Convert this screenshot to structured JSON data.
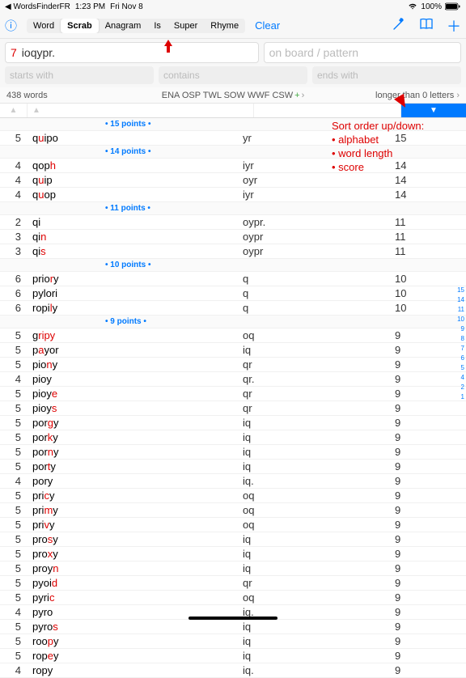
{
  "status": {
    "back": "WordsFinderFR",
    "time": "1:23 PM",
    "date": "Fri Nov 8",
    "battery": "100%"
  },
  "tabs": [
    "Word",
    "Scrab",
    "Anagram",
    "Is",
    "Super",
    "Rhyme"
  ],
  "clear": "Clear",
  "input": {
    "num": "7",
    "letters": "ioqypr.",
    "pattern_ph": "on board / pattern"
  },
  "filters": {
    "starts": "starts with",
    "contains": "contains",
    "ends": "ends with"
  },
  "info": {
    "count": "438 words",
    "dicts": "ENA OSP TWL SOW WWF CSW",
    "length": "longer than 0 letters"
  },
  "annotation": {
    "title": "Sort order up/down:",
    "l1": "• alphabet",
    "l2": "• word length",
    "l3": "• score"
  },
  "index": [
    "15",
    "14",
    "11",
    "10",
    "9",
    "8",
    "7",
    "6",
    "5",
    "4",
    "2",
    "1"
  ],
  "sections": [
    {
      "hdr": "• 15 points •",
      "rows": [
        {
          "n": "5",
          "w": [
            "q",
            "u",
            "ipo"
          ],
          "r": "yr",
          "s": "15"
        }
      ]
    },
    {
      "hdr": "• 14 points •",
      "rows": [
        {
          "n": "4",
          "w": [
            "qop",
            "h"
          ],
          "r": "iyr",
          "s": "14"
        },
        {
          "n": "4",
          "w": [
            "q",
            "u",
            "ip"
          ],
          "r": "oyr",
          "s": "14"
        },
        {
          "n": "4",
          "w": [
            "q",
            "u",
            "op"
          ],
          "r": "iyr",
          "s": "14"
        }
      ]
    },
    {
      "hdr": "• 11 points •",
      "rows": [
        {
          "n": "2",
          "w": [
            "qi"
          ],
          "r": "oypr.",
          "s": "11"
        },
        {
          "n": "3",
          "w": [
            "qi",
            "n"
          ],
          "r": "oypr",
          "s": "11"
        },
        {
          "n": "3",
          "w": [
            "qi",
            "s"
          ],
          "r": "oypr",
          "s": "11"
        }
      ]
    },
    {
      "hdr": "• 10 points •",
      "rows": [
        {
          "n": "6",
          "w": [
            "prio",
            "r",
            "y"
          ],
          "r": "q",
          "s": "10"
        },
        {
          "n": "6",
          "w": [
            "pylori"
          ],
          "r": "q",
          "s": "10"
        },
        {
          "n": "6",
          "w": [
            "ropi",
            "l",
            "y"
          ],
          "r": "q",
          "s": "10"
        }
      ]
    },
    {
      "hdr": "• 9 points •",
      "rows": [
        {
          "n": "5",
          "w": [
            "g",
            "ripy"
          ],
          "r": "oq",
          "s": "9"
        },
        {
          "n": "5",
          "w": [
            "p",
            "a",
            "yor"
          ],
          "r": "iq",
          "s": "9"
        },
        {
          "n": "5",
          "w": [
            "pio",
            "n",
            "y"
          ],
          "r": "qr",
          "s": "9"
        },
        {
          "n": "4",
          "w": [
            "pioy"
          ],
          "r": "qr.",
          "s": "9"
        },
        {
          "n": "5",
          "w": [
            "pioy",
            "e"
          ],
          "r": "qr",
          "s": "9"
        },
        {
          "n": "5",
          "w": [
            "pioy",
            "s"
          ],
          "r": "qr",
          "s": "9"
        },
        {
          "n": "5",
          "w": [
            "por",
            "g",
            "y"
          ],
          "r": "iq",
          "s": "9"
        },
        {
          "n": "5",
          "w": [
            "por",
            "k",
            "y"
          ],
          "r": "iq",
          "s": "9"
        },
        {
          "n": "5",
          "w": [
            "por",
            "n",
            "y"
          ],
          "r": "iq",
          "s": "9"
        },
        {
          "n": "5",
          "w": [
            "por",
            "t",
            "y"
          ],
          "r": "iq",
          "s": "9"
        },
        {
          "n": "4",
          "w": [
            "pory"
          ],
          "r": "iq.",
          "s": "9"
        },
        {
          "n": "5",
          "w": [
            "pri",
            "c",
            "y"
          ],
          "r": "oq",
          "s": "9"
        },
        {
          "n": "5",
          "w": [
            "pri",
            "m",
            "y"
          ],
          "r": "oq",
          "s": "9"
        },
        {
          "n": "5",
          "w": [
            "pri",
            "v",
            "y"
          ],
          "r": "oq",
          "s": "9"
        },
        {
          "n": "5",
          "w": [
            "pro",
            "s",
            "y"
          ],
          "r": "iq",
          "s": "9"
        },
        {
          "n": "5",
          "w": [
            "pro",
            "x",
            "y"
          ],
          "r": "iq",
          "s": "9"
        },
        {
          "n": "5",
          "w": [
            "proy",
            "n"
          ],
          "r": "iq",
          "s": "9"
        },
        {
          "n": "5",
          "w": [
            "pyoi",
            "d"
          ],
          "r": "qr",
          "s": "9"
        },
        {
          "n": "5",
          "w": [
            "pyri",
            "c"
          ],
          "r": "oq",
          "s": "9"
        },
        {
          "n": "4",
          "w": [
            "pyro"
          ],
          "r": "iq.",
          "s": "9"
        },
        {
          "n": "5",
          "w": [
            "pyro",
            "s"
          ],
          "r": "iq",
          "s": "9"
        },
        {
          "n": "5",
          "w": [
            "roo",
            "p",
            "y"
          ],
          "r": "iq",
          "s": "9"
        },
        {
          "n": "5",
          "w": [
            "rop",
            "e",
            "y"
          ],
          "r": "iq",
          "s": "9"
        },
        {
          "n": "4",
          "w": [
            "ropy"
          ],
          "r": "iq.",
          "s": "9"
        }
      ]
    }
  ]
}
